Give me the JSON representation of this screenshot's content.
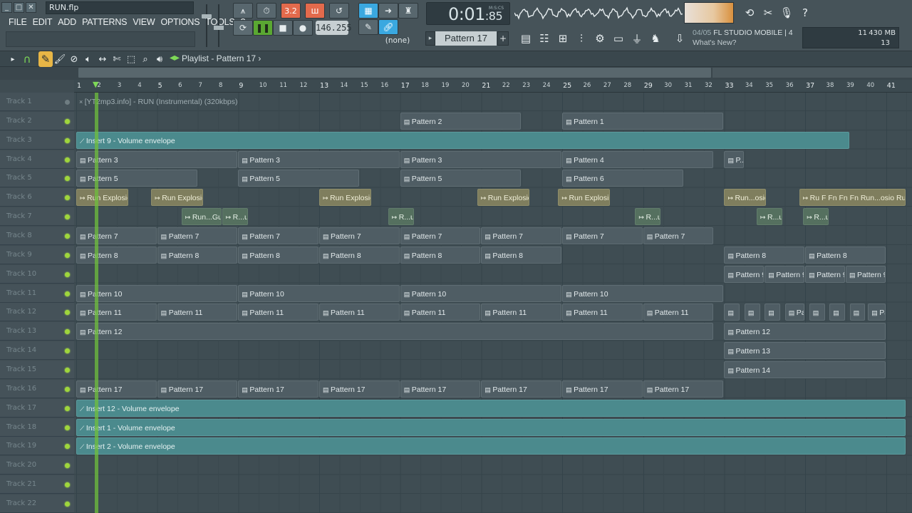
{
  "window": {
    "file_name": "RUN.flp",
    "controls": [
      "_",
      "□",
      "✕"
    ]
  },
  "menu": [
    "FILE",
    "EDIT",
    "ADD",
    "PATTERNS",
    "VIEW",
    "OPTIONS",
    "TOOLS",
    "?"
  ],
  "transport": {
    "tempo": "146.255",
    "time": "0:01",
    "time_fraction": "85",
    "time_unit": "M:S:CS",
    "snap": "(none)",
    "pattern": "Pattern 17",
    "step_label": "3.2"
  },
  "news": {
    "counter": "04/05",
    "app": "FL STUDIO MOBILE | 4",
    "headline": "What's New?"
  },
  "cpu": {
    "value1": "11",
    "memory": "430 MB",
    "polyphony": "13"
  },
  "playlist": {
    "title": "Playlist - Pattern 17",
    "title_arrow": "›"
  },
  "toolbar_icons": [
    "magnet-icon",
    "draw-icon",
    "paint-icon",
    "delete-icon",
    "mute-icon",
    "slip-icon",
    "slice-icon",
    "select-icon",
    "zoom-icon",
    "playback-icon"
  ],
  "ruler": [
    "1",
    "2",
    "3",
    "4",
    "5",
    "6",
    "7",
    "8",
    "9",
    "10",
    "11",
    "12",
    "13",
    "14",
    "15",
    "16",
    "17",
    "18",
    "19",
    "20",
    "21",
    "22",
    "23",
    "24",
    "25",
    "26",
    "27",
    "28",
    "29",
    "30",
    "31",
    "32",
    "33",
    "34",
    "35",
    "36",
    "37",
    "38",
    "39",
    "40",
    "41"
  ],
  "tracks": [
    "Track 1",
    "Track 2",
    "Track 3",
    "Track 4",
    "Track 5",
    "Track 6",
    "Track 7",
    "Track 8",
    "Track 9",
    "Track 10",
    "Track 11",
    "Track 12",
    "Track 13",
    "Track 14",
    "Track 15",
    "Track 16",
    "Track 17",
    "Track 18",
    "Track 19",
    "Track 20",
    "Track 21",
    "Track 22"
  ],
  "clips": [
    {
      "track": 1,
      "start": 1,
      "end": 42,
      "label": "[YT2mp3.info] - RUN (Instrumental) (320kbps)",
      "kind": "lead"
    },
    {
      "track": 2,
      "start": 17,
      "end": 23,
      "label": "Pattern 2",
      "kind": "pat"
    },
    {
      "track": 2,
      "start": 25,
      "end": 33,
      "label": "Pattern 1",
      "kind": "pat"
    },
    {
      "track": 3,
      "start": 1,
      "end": 39.2,
      "label": "Insert 9 - Volume envelope",
      "kind": "env"
    },
    {
      "track": 4,
      "start": 1,
      "end": 9,
      "label": "Pattern 3",
      "kind": "pat"
    },
    {
      "track": 4,
      "start": 9,
      "end": 17,
      "label": "Pattern 3",
      "kind": "pat"
    },
    {
      "track": 4,
      "start": 17,
      "end": 25,
      "label": "Pattern 3",
      "kind": "pat"
    },
    {
      "track": 4,
      "start": 25,
      "end": 32.5,
      "label": "Pattern 4",
      "kind": "pat"
    },
    {
      "track": 4,
      "start": 33,
      "end": 34,
      "label": "P...",
      "kind": "pat"
    },
    {
      "track": 5,
      "start": 1,
      "end": 7,
      "label": "Pattern 5",
      "kind": "pat"
    },
    {
      "track": 5,
      "start": 9,
      "end": 15,
      "label": "Pattern 5",
      "kind": "pat"
    },
    {
      "track": 5,
      "start": 17,
      "end": 23,
      "label": "Pattern 5",
      "kind": "pat"
    },
    {
      "track": 5,
      "start": 25,
      "end": 31,
      "label": "Pattern 6",
      "kind": "pat"
    },
    {
      "track": 6,
      "start": 1,
      "end": 3.6,
      "label": "Run Explosion",
      "kind": "aud"
    },
    {
      "track": 6,
      "start": 4.7,
      "end": 7.3,
      "label": "Run Explosion",
      "kind": "aud"
    },
    {
      "track": 6,
      "start": 13,
      "end": 15.6,
      "label": "Run Explosion",
      "kind": "aud"
    },
    {
      "track": 6,
      "start": 20.8,
      "end": 23.4,
      "label": "Run Explosion",
      "kind": "aud"
    },
    {
      "track": 6,
      "start": 24.8,
      "end": 27.4,
      "label": "Run Explosion",
      "kind": "aud"
    },
    {
      "track": 6,
      "start": 33,
      "end": 35.1,
      "label": "Run...osion",
      "kind": "aud"
    },
    {
      "track": 6,
      "start": 36.7,
      "end": 42,
      "label": "Ru F Fn Fn Fn Run...osio Run...o",
      "kind": "aud"
    },
    {
      "track": 7,
      "start": 6.2,
      "end": 8.2,
      "label": "Run...Gun",
      "kind": "aud2"
    },
    {
      "track": 7,
      "start": 8.2,
      "end": 9.5,
      "label": "R...un",
      "kind": "aud2"
    },
    {
      "track": 7,
      "start": 16.4,
      "end": 17.7,
      "label": "R...un",
      "kind": "aud2"
    },
    {
      "track": 7,
      "start": 28.6,
      "end": 29.9,
      "label": "R...un",
      "kind": "aud2"
    },
    {
      "track": 7,
      "start": 34.6,
      "end": 35.9,
      "label": "R...un",
      "kind": "aud2"
    },
    {
      "track": 7,
      "start": 36.9,
      "end": 38.2,
      "label": "R...un",
      "kind": "aud2"
    },
    {
      "track": 8,
      "start": 1,
      "end": 5,
      "label": "Pattern 7",
      "kind": "pat"
    },
    {
      "track": 8,
      "start": 5,
      "end": 9,
      "label": "Pattern 7",
      "kind": "pat"
    },
    {
      "track": 8,
      "start": 9,
      "end": 13,
      "label": "Pattern 7",
      "kind": "pat"
    },
    {
      "track": 8,
      "start": 13,
      "end": 17,
      "label": "Pattern 7",
      "kind": "pat"
    },
    {
      "track": 8,
      "start": 17,
      "end": 21,
      "label": "Pattern 7",
      "kind": "pat"
    },
    {
      "track": 8,
      "start": 21,
      "end": 25,
      "label": "Pattern 7",
      "kind": "pat"
    },
    {
      "track": 8,
      "start": 25,
      "end": 29,
      "label": "Pattern 7",
      "kind": "pat"
    },
    {
      "track": 8,
      "start": 29,
      "end": 32.5,
      "label": "Pattern 7",
      "kind": "pat"
    },
    {
      "track": 9,
      "start": 1,
      "end": 5,
      "label": "Pattern 8",
      "kind": "pat"
    },
    {
      "track": 9,
      "start": 5,
      "end": 9,
      "label": "Pattern 8",
      "kind": "pat"
    },
    {
      "track": 9,
      "start": 9,
      "end": 13,
      "label": "Pattern 8",
      "kind": "pat"
    },
    {
      "track": 9,
      "start": 13,
      "end": 17,
      "label": "Pattern 8",
      "kind": "pat"
    },
    {
      "track": 9,
      "start": 17,
      "end": 21,
      "label": "Pattern 8",
      "kind": "pat"
    },
    {
      "track": 9,
      "start": 21,
      "end": 25,
      "label": "Pattern 8",
      "kind": "pat"
    },
    {
      "track": 9,
      "start": 33,
      "end": 37,
      "label": "Pattern 8",
      "kind": "pat"
    },
    {
      "track": 9,
      "start": 37,
      "end": 41,
      "label": "Pattern 8",
      "kind": "pat"
    },
    {
      "track": 10,
      "start": 33,
      "end": 35,
      "label": "Pattern 9",
      "kind": "pat"
    },
    {
      "track": 10,
      "start": 35,
      "end": 37,
      "label": "Pattern 9",
      "kind": "pat"
    },
    {
      "track": 10,
      "start": 37,
      "end": 39,
      "label": "Pattern 9",
      "kind": "pat"
    },
    {
      "track": 10,
      "start": 39,
      "end": 41,
      "label": "Pattern 9",
      "kind": "pat"
    },
    {
      "track": 11,
      "start": 1,
      "end": 9,
      "label": "Pattern 10",
      "kind": "pat"
    },
    {
      "track": 11,
      "start": 9,
      "end": 17,
      "label": "Pattern 10",
      "kind": "pat"
    },
    {
      "track": 11,
      "start": 17,
      "end": 25,
      "label": "Pattern 10",
      "kind": "pat"
    },
    {
      "track": 11,
      "start": 25,
      "end": 33,
      "label": "Pattern 10",
      "kind": "pat"
    },
    {
      "track": 12,
      "start": 1,
      "end": 5,
      "label": "Pattern 11",
      "kind": "pat"
    },
    {
      "track": 12,
      "start": 5,
      "end": 9,
      "label": "Pattern 11",
      "kind": "pat"
    },
    {
      "track": 12,
      "start": 9,
      "end": 13,
      "label": "Pattern 11",
      "kind": "pat"
    },
    {
      "track": 12,
      "start": 13,
      "end": 17,
      "label": "Pattern 11",
      "kind": "pat"
    },
    {
      "track": 12,
      "start": 17,
      "end": 21,
      "label": "Pattern 11",
      "kind": "pat"
    },
    {
      "track": 12,
      "start": 21,
      "end": 25,
      "label": "Pattern 11",
      "kind": "pat"
    },
    {
      "track": 12,
      "start": 25,
      "end": 29,
      "label": "Pattern 11",
      "kind": "pat"
    },
    {
      "track": 12,
      "start": 29,
      "end": 32.5,
      "label": "Pattern 11",
      "kind": "pat"
    },
    {
      "track": 12,
      "start": 33,
      "end": 33.8,
      "label": "",
      "kind": "pat"
    },
    {
      "track": 12,
      "start": 34,
      "end": 34.8,
      "label": "",
      "kind": "pat"
    },
    {
      "track": 12,
      "start": 35,
      "end": 35.8,
      "label": "",
      "kind": "pat"
    },
    {
      "track": 12,
      "start": 36,
      "end": 37,
      "label": "Pa...1",
      "kind": "pat"
    },
    {
      "track": 12,
      "start": 37.2,
      "end": 38,
      "label": "",
      "kind": "pat"
    },
    {
      "track": 12,
      "start": 38.2,
      "end": 39,
      "label": "",
      "kind": "pat"
    },
    {
      "track": 12,
      "start": 39.2,
      "end": 40,
      "label": "",
      "kind": "pat"
    },
    {
      "track": 12,
      "start": 40.1,
      "end": 41,
      "label": "Pa...1",
      "kind": "pat"
    },
    {
      "track": 13,
      "start": 1,
      "end": 32.5,
      "label": "Pattern 12",
      "kind": "pat"
    },
    {
      "track": 13,
      "start": 33,
      "end": 41,
      "label": "Pattern 12",
      "kind": "pat"
    },
    {
      "track": 14,
      "start": 33,
      "end": 41,
      "label": "Pattern 13",
      "kind": "pat"
    },
    {
      "track": 15,
      "start": 33,
      "end": 41,
      "label": "Pattern 14",
      "kind": "pat"
    },
    {
      "track": 16,
      "start": 1,
      "end": 5,
      "label": "Pattern 17",
      "kind": "pat"
    },
    {
      "track": 16,
      "start": 5,
      "end": 9,
      "label": "Pattern 17",
      "kind": "pat"
    },
    {
      "track": 16,
      "start": 9,
      "end": 13,
      "label": "Pattern 17",
      "kind": "pat"
    },
    {
      "track": 16,
      "start": 13,
      "end": 17,
      "label": "Pattern 17",
      "kind": "pat"
    },
    {
      "track": 16,
      "start": 17,
      "end": 21,
      "label": "Pattern 17",
      "kind": "pat"
    },
    {
      "track": 16,
      "start": 21,
      "end": 25,
      "label": "Pattern 17",
      "kind": "pat"
    },
    {
      "track": 16,
      "start": 25,
      "end": 29,
      "label": "Pattern 17",
      "kind": "pat"
    },
    {
      "track": 16,
      "start": 29,
      "end": 33,
      "label": "Pattern 17",
      "kind": "pat"
    },
    {
      "track": 17,
      "start": 1,
      "end": 42,
      "label": "Insert 12 - Volume envelope",
      "kind": "env"
    },
    {
      "track": 18,
      "start": 1,
      "end": 42,
      "label": "Insert 1 - Volume envelope",
      "kind": "env"
    },
    {
      "track": 19,
      "start": 1,
      "end": 42,
      "label": "Insert 2 - Volume envelope",
      "kind": "env"
    }
  ],
  "colors": {
    "accent_green": "#7ed957",
    "envelope": "#4b8a8d",
    "audio": "#7f7e5e",
    "pattern": "#4f5d64"
  }
}
